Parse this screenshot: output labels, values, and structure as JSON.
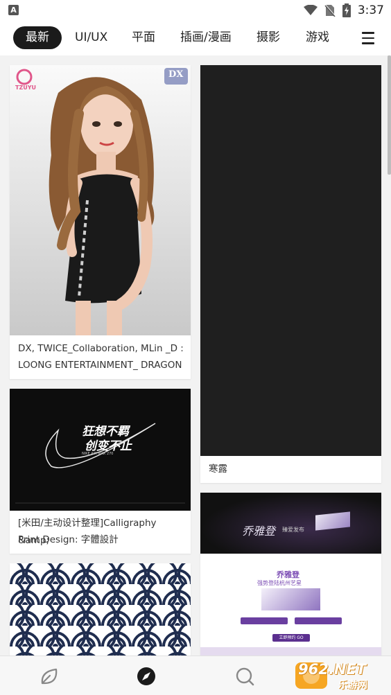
{
  "status_bar": {
    "time": "3:37",
    "app_indicator": "A"
  },
  "tabs": [
    {
      "label": "最新",
      "active": true
    },
    {
      "label": "UI/UX",
      "active": false
    },
    {
      "label": "平面",
      "active": false
    },
    {
      "label": "插画/漫画",
      "active": false
    },
    {
      "label": "摄影",
      "active": false
    },
    {
      "label": "游戏",
      "active": false
    }
  ],
  "feed": {
    "left": [
      {
        "caption_line1": "DX, TWICE_Collaboration, MLin _D :",
        "caption_line2": "LOONG ENTERTAINMENT_ DRAGON R...",
        "logo_text": "TZUYU",
        "corner_text": "DX"
      },
      {
        "caption_line1": "[米田/主动设计整理]Calligraphy &amp;",
        "caption_line2": "Print Design: 字體設計",
        "art_line1": "狂想不羁",
        "art_line2": "创变不止",
        "art_line3": "NIKE AIR MAX 270"
      },
      {
        "caption_line1": "",
        "caption_line2": ""
      }
    ],
    "right": [
      {
        "caption": "寒露"
      },
      {
        "banner_title": "乔雅登",
        "banner_sub": "臻爱发布",
        "sub_title": "乔雅登",
        "sub_tagline": "强势登陆杭州艺星",
        "cta": "立即预约 GO"
      }
    ]
  },
  "watermark": {
    "main": "962.NET",
    "sub": "乐游网"
  },
  "colors": {
    "active_tab_bg": "#1b1b1b",
    "page_bg": "#f2f2f2",
    "accent_purple": "#6a3fa0"
  }
}
